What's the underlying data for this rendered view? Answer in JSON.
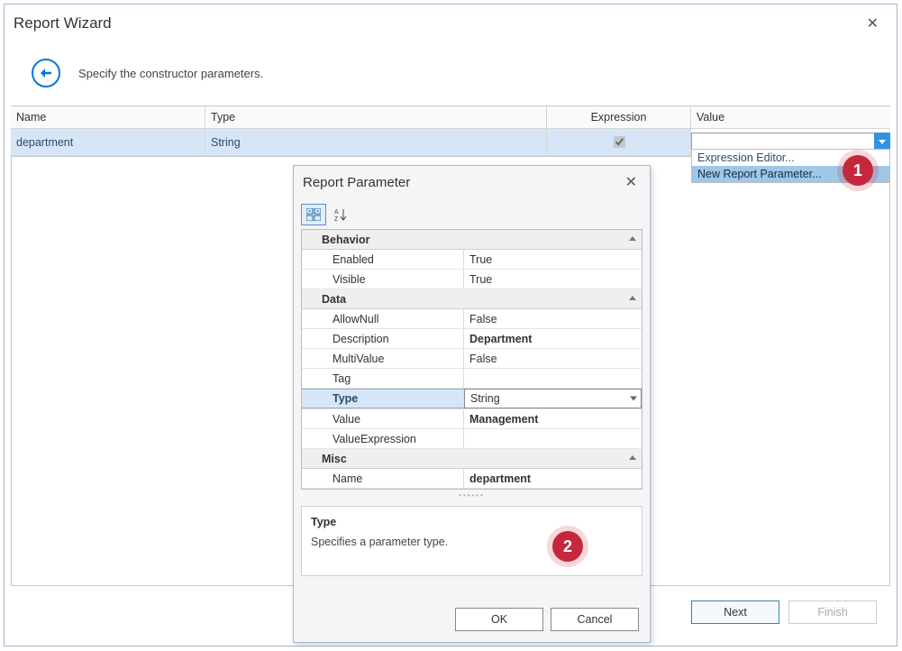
{
  "wizard": {
    "title": "Report Wizard",
    "instruction": "Specify the constructor parameters.",
    "columns": {
      "name": "Name",
      "type": "Type",
      "expression": "Expression",
      "value": "Value"
    },
    "row": {
      "name": "department",
      "type": "String",
      "expression_checked": true,
      "value": ""
    },
    "dropdown": {
      "item1": "Expression Editor...",
      "item2": "New Report Parameter..."
    },
    "buttons": {
      "next": "Next",
      "finish": "Finish"
    }
  },
  "badges": {
    "one": "1",
    "two": "2"
  },
  "popup": {
    "title": "Report Parameter",
    "categories": {
      "behavior": "Behavior",
      "data": "Data",
      "misc": "Misc"
    },
    "props": {
      "enabled": {
        "label": "Enabled",
        "value": "True"
      },
      "visible": {
        "label": "Visible",
        "value": "True"
      },
      "allownull": {
        "label": "AllowNull",
        "value": "False"
      },
      "description": {
        "label": "Description",
        "value": "Department"
      },
      "multivalue": {
        "label": "MultiValue",
        "value": "False"
      },
      "tag": {
        "label": "Tag",
        "value": ""
      },
      "type": {
        "label": "Type",
        "value": "String"
      },
      "value": {
        "label": "Value",
        "value": "Management"
      },
      "valueexpr": {
        "label": "ValueExpression",
        "value": ""
      },
      "name": {
        "label": "Name",
        "value": "department"
      }
    },
    "description": {
      "title": "Type",
      "text": "Specifies a parameter type."
    },
    "buttons": {
      "ok": "OK",
      "cancel": "Cancel"
    }
  }
}
